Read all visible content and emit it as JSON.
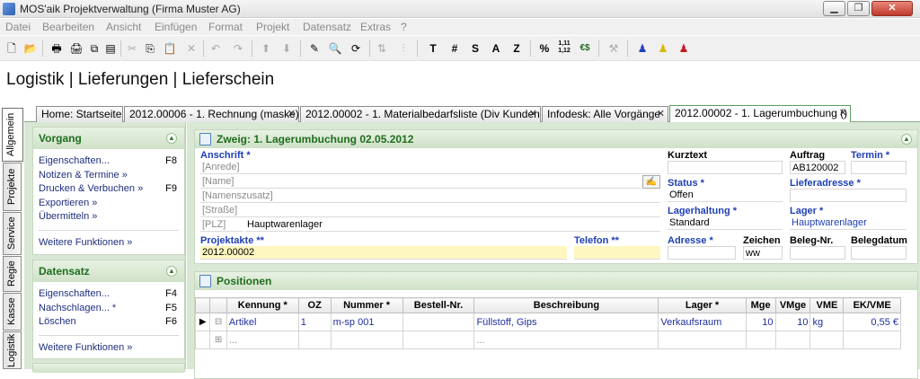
{
  "window": {
    "title": "MOS'aik Projektverwaltung (Firma Muster AG)"
  },
  "menu": [
    "Datei",
    "Bearbeiten",
    "Ansicht",
    "Einfügen",
    "Format",
    "Projekt",
    "Datensatz",
    "Extras",
    "?"
  ],
  "toolbar": {
    "btn_t": "T",
    "btn_hash": "#",
    "btn_s": "S",
    "btn_a": "A",
    "btn_z": "Z",
    "btn_percent": "%",
    "btn_decimals_top": "1,11",
    "btn_decimals_bottom": "1,12",
    "btn_currency": "€$"
  },
  "breadcrumb": "Logistik | Lieferungen | Lieferschein",
  "vtabs": [
    "Allgemein",
    "Projekte",
    "Service",
    "Regie",
    "Kasse",
    "Logistik"
  ],
  "tabs": [
    {
      "label": "Home: Startseite",
      "closable": false
    },
    {
      "label": "2012.00006 - 1. Rechnung (maske)",
      "closable": true
    },
    {
      "label": "2012.00002 - 1. Materialbedarfsliste (Div Kunden)",
      "closable": true
    },
    {
      "label": "Infodesk: Alle Vorgänge",
      "closable": true
    },
    {
      "label": "2012.00002 - 1. Lagerumbuchung ()",
      "closable": true
    }
  ],
  "vorgang": {
    "title": "Vorgang",
    "items": [
      {
        "label": "Eigenschaften...",
        "key": "F8"
      },
      {
        "label": "Notizen & Termine »",
        "key": ""
      },
      {
        "label": "Drucken & Verbuchen »",
        "key": "F9"
      },
      {
        "label": "Exportieren »",
        "key": ""
      },
      {
        "label": "Übermitteln »",
        "key": ""
      }
    ],
    "more": "Weitere Funktionen »"
  },
  "datensatz": {
    "title": "Datensatz",
    "items": [
      {
        "label": "Eigenschaften...",
        "key": "F4"
      },
      {
        "label": "Nachschlagen... *",
        "key": "F5"
      },
      {
        "label": "Löschen",
        "key": "F6"
      }
    ],
    "more": "Weitere Funktionen »"
  },
  "zweig": {
    "title": "Zweig: 1. Lagerumbuchung 02.05.2012",
    "anschrift_label": "Anschrift *",
    "anrede": "[Anrede]",
    "name": "[Name]",
    "namenszusatz": "[Namenszusatz]",
    "strasse": "[Straße]",
    "plz": "[PLZ]",
    "ort": "Hauptwarenlager",
    "projektakte_label": "Projektakte **",
    "projektakte": "2012.00002",
    "telefon_label": "Telefon **",
    "telefon": "",
    "kurztext_label": "Kurztext",
    "kurztext": "",
    "status_label": "Status *",
    "status": "Offen",
    "lagerhaltung_label": "Lagerhaltung *",
    "lagerhaltung": "Standard",
    "adresse_label": "Adresse *",
    "adresse": "",
    "zeichen_label": "Zeichen",
    "zeichen": "ww",
    "auftrag_label": "Auftrag",
    "auftrag": "AB120002",
    "termin_label": "Termin *",
    "termin": "",
    "lieferadresse_label": "Lieferadresse *",
    "lieferadresse": "",
    "lager_label": "Lager *",
    "lager": "Hauptwarenlager",
    "belegnr_label": "Beleg-Nr.",
    "belegnr": "",
    "belegdatum_label": "Belegdatum",
    "belegdatum": ""
  },
  "positionen": {
    "title": "Positionen",
    "columns": [
      "Kennung *",
      "OZ",
      "Nummer *",
      "Bestell-Nr.",
      "Beschreibung",
      "Lager *",
      "Mge",
      "VMge",
      "VME",
      "EK/VME"
    ],
    "rows": [
      {
        "kennung": "Artikel",
        "oz": "1",
        "nummer": "m-sp 001",
        "bestellnr": "",
        "beschreibung": "Füllstoff, Gips",
        "lager": "Verkaufsraum",
        "mge": "10",
        "vmge": "10",
        "vme": "kg",
        "ek": "0,55 €"
      },
      {
        "kennung": "...",
        "oz": "",
        "nummer": "",
        "bestellnr": "",
        "beschreibung": "...",
        "lager": "",
        "mge": "",
        "vmge": "",
        "vme": "",
        "ek": ""
      }
    ]
  },
  "colors": {
    "accent": "#1e6d1e",
    "link": "#1f2f7f",
    "panel_bg": "#d9e8d4",
    "highlight": "#fff6c0"
  }
}
